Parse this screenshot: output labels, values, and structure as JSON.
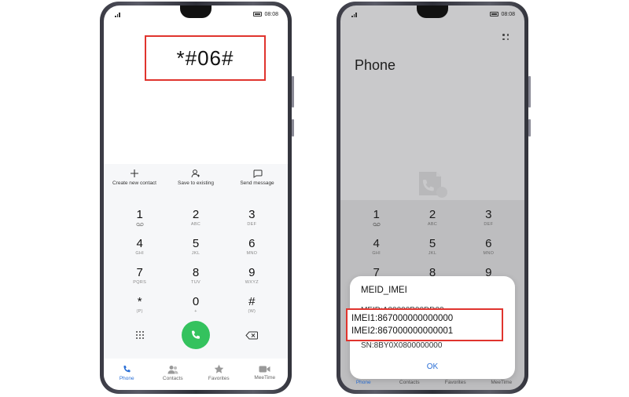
{
  "status": {
    "time": "08:08"
  },
  "left": {
    "dialed_code": "*#06#",
    "actions": [
      {
        "label": "Create new contact",
        "icon": "plus-icon"
      },
      {
        "label": "Save to existing",
        "icon": "person-add-icon"
      },
      {
        "label": "Send message",
        "icon": "message-icon"
      }
    ],
    "keys": [
      {
        "d": "1",
        "l": ""
      },
      {
        "d": "2",
        "l": "ABC"
      },
      {
        "d": "3",
        "l": "DEF"
      },
      {
        "d": "4",
        "l": "GHI"
      },
      {
        "d": "5",
        "l": "JKL"
      },
      {
        "d": "6",
        "l": "MNO"
      },
      {
        "d": "7",
        "l": "PQRS"
      },
      {
        "d": "8",
        "l": "TUV"
      },
      {
        "d": "9",
        "l": "WXYZ"
      },
      {
        "d": "*",
        "l": "(P)"
      },
      {
        "d": "0",
        "l": "+"
      },
      {
        "d": "#",
        "l": "(W)"
      }
    ],
    "nav": [
      {
        "label": "Phone",
        "icon": "phone-icon"
      },
      {
        "label": "Contacts",
        "icon": "contacts-icon"
      },
      {
        "label": "Favorites",
        "icon": "star-icon"
      },
      {
        "label": "MeeTime",
        "icon": "video-icon"
      }
    ]
  },
  "right": {
    "app_title": "Phone",
    "dialog": {
      "title": "MEID_IMEI",
      "meid": "MEID:A00000B00DD00",
      "imei1": "IMEI1:867000000000000",
      "imei2": "IMEI2:867000000000001",
      "sn": "SN:8BY0X0800000000",
      "ok_label": "OK"
    }
  }
}
